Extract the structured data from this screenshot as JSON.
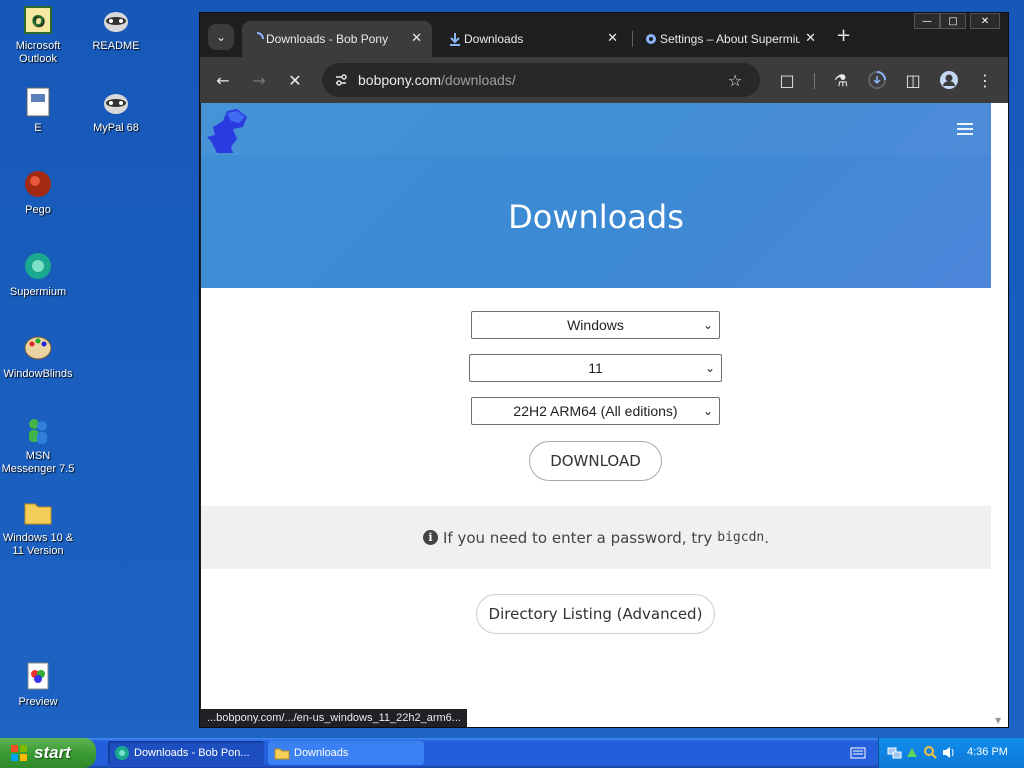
{
  "desktop": {
    "icons": [
      {
        "label": "Microsoft Outlook"
      },
      {
        "label": "README"
      },
      {
        "label": "E"
      },
      {
        "label": "MyPal 68"
      },
      {
        "label": "Pego"
      },
      {
        "label": "Supermium"
      },
      {
        "label": "WindowBlinds"
      },
      {
        "label": "MSN Messenger 7.5"
      },
      {
        "label": "Windows 10 & 11 Version"
      },
      {
        "label": "Preview"
      }
    ]
  },
  "browser": {
    "tabs": [
      {
        "title": "Downloads - Bob Pony",
        "icon": "loading-spinner-icon",
        "active": true
      },
      {
        "title": "Downloads",
        "icon": "download-icon",
        "active": false
      },
      {
        "title": "Settings – About Supermium",
        "icon": "gear-icon",
        "active": false
      }
    ],
    "new_tab_label": "+",
    "url_host": "bobpony.com",
    "url_path": "/downloads/",
    "status_text": "...bobpony.com/.../en-us_windows_11_22h2_arm6..."
  },
  "page": {
    "title": "Downloads",
    "os_select": {
      "value": "Windows"
    },
    "version_select": {
      "value": "11"
    },
    "edition_select": {
      "value": "22H2 ARM64 (All editions)"
    },
    "download_button": "DOWNLOAD",
    "notice_text": "If you need to enter a password, try",
    "notice_code": "bigcdn",
    "notice_period": ".",
    "directory_button": "Directory Listing (Advanced)"
  },
  "taskbar": {
    "start_label": "start",
    "tasks": [
      {
        "label": "Downloads - Bob Pon...",
        "active": true
      },
      {
        "label": "Downloads",
        "active": false
      }
    ],
    "clock": "4:36 PM"
  },
  "colors": {
    "hero_blue": "#3f8fd6",
    "desktop_blue": "#1a5fbf",
    "browser_dark": "#1f1f1f"
  }
}
